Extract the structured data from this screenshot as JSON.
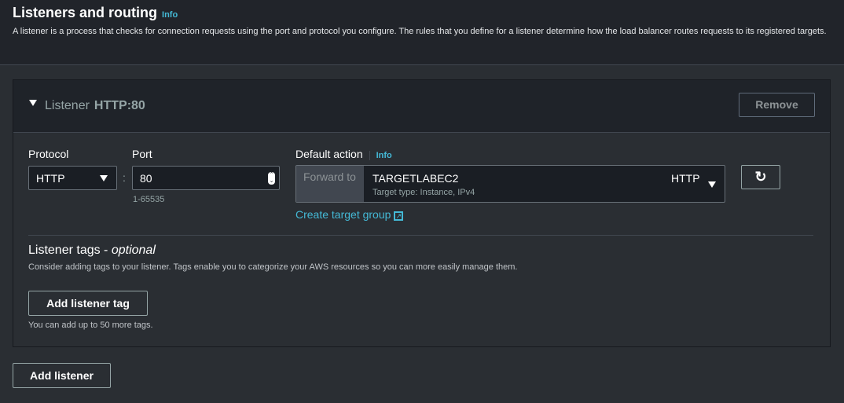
{
  "section": {
    "title": "Listeners and routing",
    "info": "Info",
    "description": "A listener is a process that checks for connection requests using the port and protocol you configure. The rules that you define for a listener determine how the load balancer routes requests to its registered targets."
  },
  "listener": {
    "label": "Listener",
    "name": "HTTP:80",
    "remove": "Remove",
    "protocol_label": "Protocol",
    "protocol_value": "HTTP",
    "separator": ":",
    "port_label": "Port",
    "port_value": "80",
    "port_hint": "1-65535",
    "default_action_label": "Default action",
    "default_action_info": "Info",
    "forward_to": "Forward to",
    "target_group": "TARGETLABEC2",
    "target_type": "Target type: Instance, IPv4",
    "target_protocol": "HTTP",
    "create_target_group": "Create target group",
    "tags_title": "Listener tags - ",
    "tags_optional": "optional",
    "tags_desc": "Consider adding tags to your listener. Tags enable you to categorize your AWS resources so you can more easily manage them.",
    "add_tag": "Add listener tag",
    "tags_hint": "You can add up to 50 more tags."
  },
  "add_listener": "Add listener",
  "colors": {
    "accent": "#44b9d6",
    "background": "#2a2e33",
    "header": "#21242a"
  }
}
